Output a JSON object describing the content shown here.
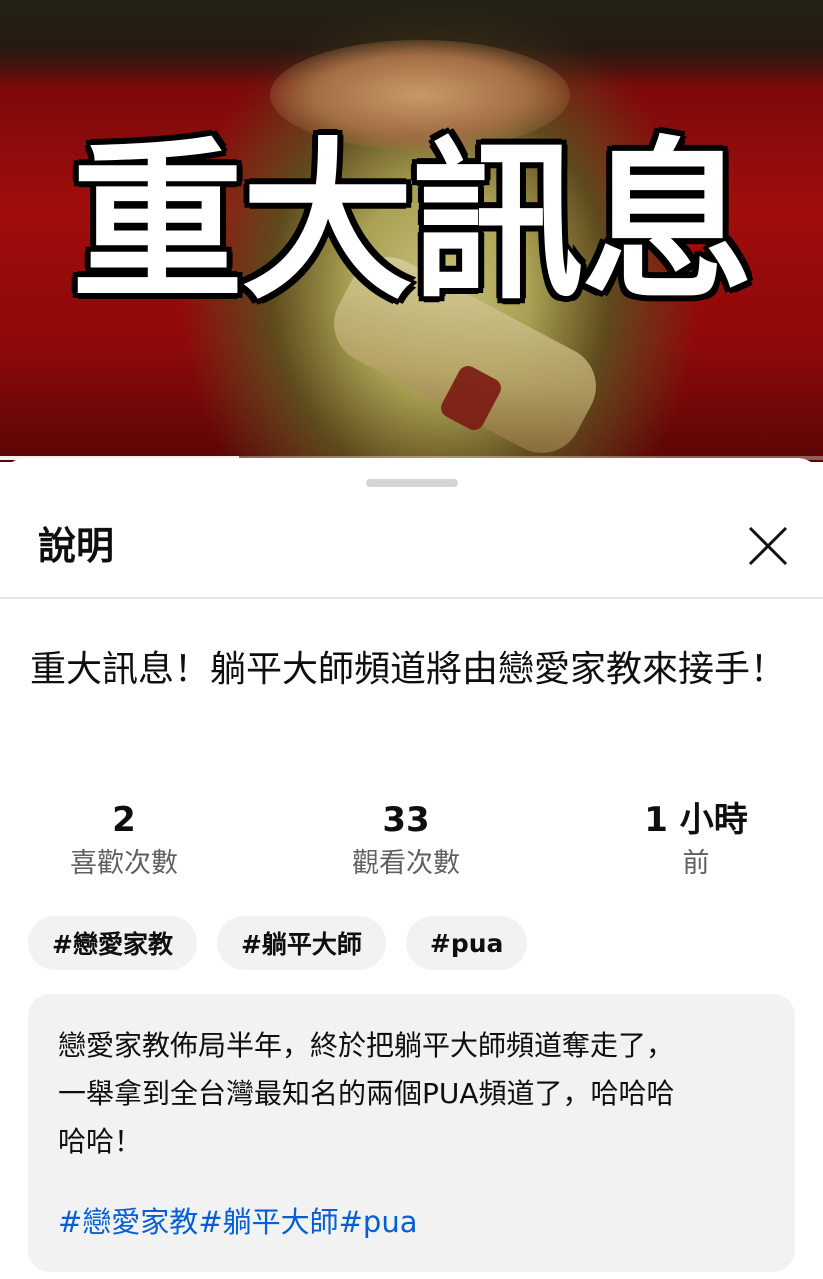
{
  "video": {
    "overlay_text": "重大訊息",
    "progress": 0.29
  },
  "sheet": {
    "title": "說明",
    "close_icon": "close-icon"
  },
  "video_title": "重大訊息！躺平大師頻道將由戀愛家教來接手！",
  "stats": {
    "likes": {
      "value": "2",
      "label": "喜歡次數"
    },
    "views": {
      "value": "33",
      "label": "觀看次數"
    },
    "time": {
      "value": "1 小時",
      "label": "前"
    }
  },
  "chips": [
    "#戀愛家教",
    "#躺平大師",
    "#pua"
  ],
  "description": {
    "body": "戀愛家教佈局半年，終於把躺平大師頻道奪走了，\n一舉拿到全台灣最知名的兩個PUA頻道了，哈哈哈\n哈哈！",
    "hashtags": [
      "#戀愛家教",
      "#躺平大師",
      "#pua"
    ]
  },
  "colors": {
    "link": "#065fd4",
    "chip_bg": "#f2f2f2",
    "secondary_text": "#606060"
  }
}
